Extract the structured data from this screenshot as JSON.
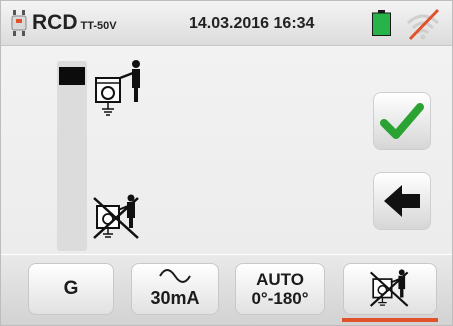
{
  "header": {
    "mode": "RCD",
    "mode_sub": "TT-50V",
    "datetime": "14.03.2016  16:34",
    "battery_color": "#27b24a",
    "wifi_slash_color": "#e0522c"
  },
  "main": {
    "indicator_level": 0.1,
    "confirm_color": "#2aa332"
  },
  "bottom": {
    "tabs": [
      {
        "label": "G"
      },
      {
        "label": "30mA"
      },
      {
        "line1": "AUTO",
        "line2": "0°-180°"
      }
    ],
    "selected_tab_index": 3,
    "accent": "#e0522c"
  },
  "icons": [
    "rcd-device-icon",
    "battery-icon",
    "wifi-disabled-icon",
    "contact-person-icon",
    "no-contact-icon",
    "checkmark-icon",
    "back-arrow-icon",
    "sine-wave-icon"
  ]
}
